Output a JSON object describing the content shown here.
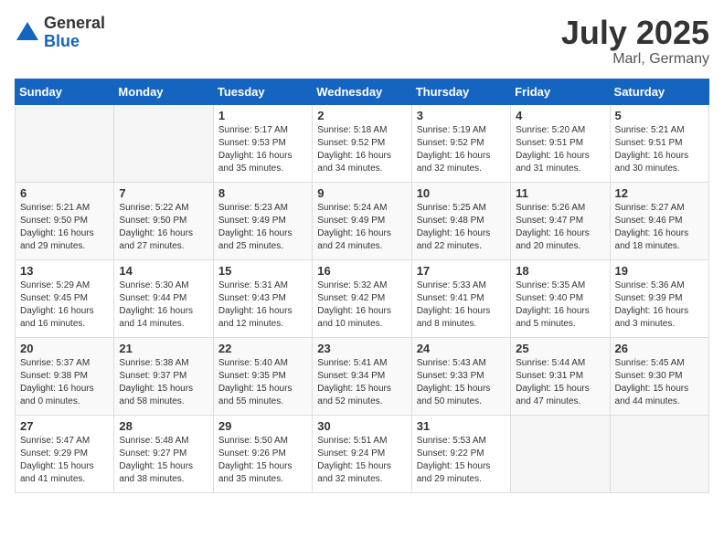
{
  "logo": {
    "general": "General",
    "blue": "Blue"
  },
  "title": {
    "month_year": "July 2025",
    "location": "Marl, Germany"
  },
  "weekdays": [
    "Sunday",
    "Monday",
    "Tuesday",
    "Wednesday",
    "Thursday",
    "Friday",
    "Saturday"
  ],
  "weeks": [
    [
      {
        "day": "",
        "info": ""
      },
      {
        "day": "",
        "info": ""
      },
      {
        "day": "1",
        "info": "Sunrise: 5:17 AM\nSunset: 9:53 PM\nDaylight: 16 hours and 35 minutes."
      },
      {
        "day": "2",
        "info": "Sunrise: 5:18 AM\nSunset: 9:52 PM\nDaylight: 16 hours and 34 minutes."
      },
      {
        "day": "3",
        "info": "Sunrise: 5:19 AM\nSunset: 9:52 PM\nDaylight: 16 hours and 32 minutes."
      },
      {
        "day": "4",
        "info": "Sunrise: 5:20 AM\nSunset: 9:51 PM\nDaylight: 16 hours and 31 minutes."
      },
      {
        "day": "5",
        "info": "Sunrise: 5:21 AM\nSunset: 9:51 PM\nDaylight: 16 hours and 30 minutes."
      }
    ],
    [
      {
        "day": "6",
        "info": "Sunrise: 5:21 AM\nSunset: 9:50 PM\nDaylight: 16 hours and 29 minutes."
      },
      {
        "day": "7",
        "info": "Sunrise: 5:22 AM\nSunset: 9:50 PM\nDaylight: 16 hours and 27 minutes."
      },
      {
        "day": "8",
        "info": "Sunrise: 5:23 AM\nSunset: 9:49 PM\nDaylight: 16 hours and 25 minutes."
      },
      {
        "day": "9",
        "info": "Sunrise: 5:24 AM\nSunset: 9:49 PM\nDaylight: 16 hours and 24 minutes."
      },
      {
        "day": "10",
        "info": "Sunrise: 5:25 AM\nSunset: 9:48 PM\nDaylight: 16 hours and 22 minutes."
      },
      {
        "day": "11",
        "info": "Sunrise: 5:26 AM\nSunset: 9:47 PM\nDaylight: 16 hours and 20 minutes."
      },
      {
        "day": "12",
        "info": "Sunrise: 5:27 AM\nSunset: 9:46 PM\nDaylight: 16 hours and 18 minutes."
      }
    ],
    [
      {
        "day": "13",
        "info": "Sunrise: 5:29 AM\nSunset: 9:45 PM\nDaylight: 16 hours and 16 minutes."
      },
      {
        "day": "14",
        "info": "Sunrise: 5:30 AM\nSunset: 9:44 PM\nDaylight: 16 hours and 14 minutes."
      },
      {
        "day": "15",
        "info": "Sunrise: 5:31 AM\nSunset: 9:43 PM\nDaylight: 16 hours and 12 minutes."
      },
      {
        "day": "16",
        "info": "Sunrise: 5:32 AM\nSunset: 9:42 PM\nDaylight: 16 hours and 10 minutes."
      },
      {
        "day": "17",
        "info": "Sunrise: 5:33 AM\nSunset: 9:41 PM\nDaylight: 16 hours and 8 minutes."
      },
      {
        "day": "18",
        "info": "Sunrise: 5:35 AM\nSunset: 9:40 PM\nDaylight: 16 hours and 5 minutes."
      },
      {
        "day": "19",
        "info": "Sunrise: 5:36 AM\nSunset: 9:39 PM\nDaylight: 16 hours and 3 minutes."
      }
    ],
    [
      {
        "day": "20",
        "info": "Sunrise: 5:37 AM\nSunset: 9:38 PM\nDaylight: 16 hours and 0 minutes."
      },
      {
        "day": "21",
        "info": "Sunrise: 5:38 AM\nSunset: 9:37 PM\nDaylight: 15 hours and 58 minutes."
      },
      {
        "day": "22",
        "info": "Sunrise: 5:40 AM\nSunset: 9:35 PM\nDaylight: 15 hours and 55 minutes."
      },
      {
        "day": "23",
        "info": "Sunrise: 5:41 AM\nSunset: 9:34 PM\nDaylight: 15 hours and 52 minutes."
      },
      {
        "day": "24",
        "info": "Sunrise: 5:43 AM\nSunset: 9:33 PM\nDaylight: 15 hours and 50 minutes."
      },
      {
        "day": "25",
        "info": "Sunrise: 5:44 AM\nSunset: 9:31 PM\nDaylight: 15 hours and 47 minutes."
      },
      {
        "day": "26",
        "info": "Sunrise: 5:45 AM\nSunset: 9:30 PM\nDaylight: 15 hours and 44 minutes."
      }
    ],
    [
      {
        "day": "27",
        "info": "Sunrise: 5:47 AM\nSunset: 9:29 PM\nDaylight: 15 hours and 41 minutes."
      },
      {
        "day": "28",
        "info": "Sunrise: 5:48 AM\nSunset: 9:27 PM\nDaylight: 15 hours and 38 minutes."
      },
      {
        "day": "29",
        "info": "Sunrise: 5:50 AM\nSunset: 9:26 PM\nDaylight: 15 hours and 35 minutes."
      },
      {
        "day": "30",
        "info": "Sunrise: 5:51 AM\nSunset: 9:24 PM\nDaylight: 15 hours and 32 minutes."
      },
      {
        "day": "31",
        "info": "Sunrise: 5:53 AM\nSunset: 9:22 PM\nDaylight: 15 hours and 29 minutes."
      },
      {
        "day": "",
        "info": ""
      },
      {
        "day": "",
        "info": ""
      }
    ]
  ]
}
